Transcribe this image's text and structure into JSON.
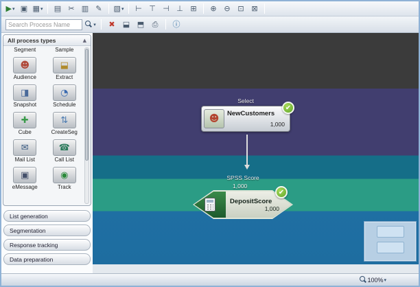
{
  "icons": {
    "dropdown": "▾",
    "chevron_up": "▲",
    "check": "✔"
  },
  "toolbar": {
    "row1": [
      {
        "name": "run-flowchart-menu",
        "glyph": "▶"
      },
      {
        "name": "process-config",
        "glyph": "▣"
      },
      {
        "name": "layout-menu",
        "glyph": "▦"
      },
      {
        "name": "copy",
        "glyph": "▤"
      },
      {
        "name": "cut",
        "glyph": "✂"
      },
      {
        "name": "paste",
        "glyph": "▥"
      },
      {
        "name": "annotate",
        "glyph": "✎"
      },
      {
        "name": "display-options-menu",
        "glyph": "▧"
      },
      {
        "name": "align-left",
        "glyph": "⊢"
      },
      {
        "name": "align-top",
        "glyph": "⊤"
      },
      {
        "name": "align-right",
        "glyph": "⊣"
      },
      {
        "name": "align-bottom",
        "glyph": "⊥"
      },
      {
        "name": "snap-grid",
        "glyph": "⊞"
      },
      {
        "name": "zoom-in",
        "glyph": "⊕"
      },
      {
        "name": "zoom-out",
        "glyph": "⊖"
      },
      {
        "name": "zoom-region",
        "glyph": "⊡"
      },
      {
        "name": "fit-to-window",
        "glyph": "⊠"
      }
    ],
    "row2": {
      "search_placeholder": "Search Process Name",
      "icons": [
        {
          "name": "delete",
          "glyph": "✖",
          "color": "#c0392b"
        },
        {
          "name": "save",
          "glyph": "⬓"
        },
        {
          "name": "save-as",
          "glyph": "⬒"
        },
        {
          "name": "print",
          "glyph": "⎙"
        },
        {
          "name": "info",
          "glyph": "ⓘ",
          "color": "#2e6da4"
        }
      ]
    }
  },
  "palette": {
    "header": "All process types",
    "items": [
      {
        "label": "Segment",
        "glyph": "▤",
        "color": "#6a8a3a"
      },
      {
        "label": "Sample",
        "glyph": "▦",
        "color": "#4a7ab0"
      },
      {
        "label": "Audience",
        "glyph": "☻",
        "color": "#b04a3a"
      },
      {
        "label": "Extract",
        "glyph": "⬓",
        "color": "#b08a2a"
      },
      {
        "label": "Snapshot",
        "glyph": "◨",
        "color": "#4a6a9a"
      },
      {
        "label": "Schedule",
        "glyph": "◔",
        "color": "#3a6ab0"
      },
      {
        "label": "Cube",
        "glyph": "✚",
        "color": "#3a9a4a"
      },
      {
        "label": "CreateSeg",
        "glyph": "⇅",
        "color": "#4a7ab0"
      },
      {
        "label": "Mail List",
        "glyph": "✉",
        "color": "#3a5a80"
      },
      {
        "label": "Call List",
        "glyph": "☎",
        "color": "#2a7a5a"
      },
      {
        "label": "eMessage",
        "glyph": "▣",
        "color": "#44506a"
      },
      {
        "label": "Track",
        "glyph": "◉",
        "color": "#2a8a3a"
      }
    ]
  },
  "accordions": [
    {
      "label": "List generation"
    },
    {
      "label": "Segmentation"
    },
    {
      "label": "Response tracking"
    },
    {
      "label": "Data preparation"
    }
  ],
  "canvas": {
    "nodes": {
      "select": {
        "type_label": "Select",
        "name": "NewCustomers",
        "count": "1,000"
      },
      "score": {
        "type_label": "SPSS Score",
        "input_count": "1,000",
        "name": "DepositScore",
        "count": "1,000"
      }
    }
  },
  "statusbar": {
    "zoom": "100%"
  },
  "colors": {
    "band_charcoal": "#3b3b3b",
    "band_purple": "#413e6f",
    "band_teal": "#156e88",
    "band_green": "#2b9c85",
    "band_blue": "#1f6fa3",
    "success_green": "#61a62a"
  }
}
